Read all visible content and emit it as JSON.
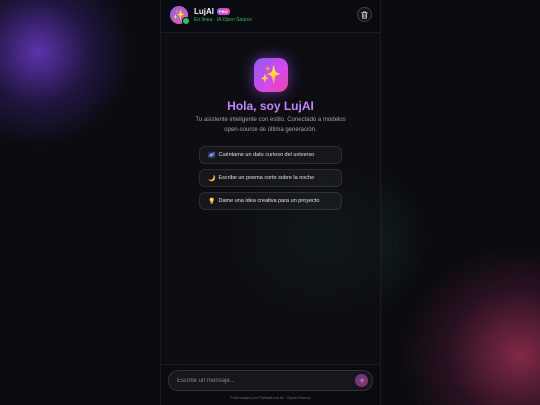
{
  "header": {
    "avatar_icon": "✨",
    "title": "LujAI",
    "badge": "PRO",
    "status": "En línea · IA Open Source",
    "trash_icon": "trash-icon"
  },
  "hero": {
    "icon": "✨",
    "greeting": "Hola, soy LujAI",
    "subtitle": "Tu asistente inteligente con estilo. Conectado a modelos open-source de última generación."
  },
  "suggestions": [
    {
      "emoji": "🌌",
      "label": "Cuéntame un dato curioso del universo"
    },
    {
      "emoji": "🌙",
      "label": "Escribe un poema corto sobre la noche"
    },
    {
      "emoji": "💡",
      "label": "Dame una idea creativa para un proyecto"
    }
  ],
  "composer": {
    "placeholder": "Escribe un mensaje...",
    "value": ""
  },
  "footer": {
    "powered_by": "Potenciado por Pollinations.AI · Open Source"
  },
  "colors": {
    "accent": "#a855f7",
    "accent2": "#ec4899",
    "status": "#22c55e",
    "greeting": "#c084fc"
  }
}
